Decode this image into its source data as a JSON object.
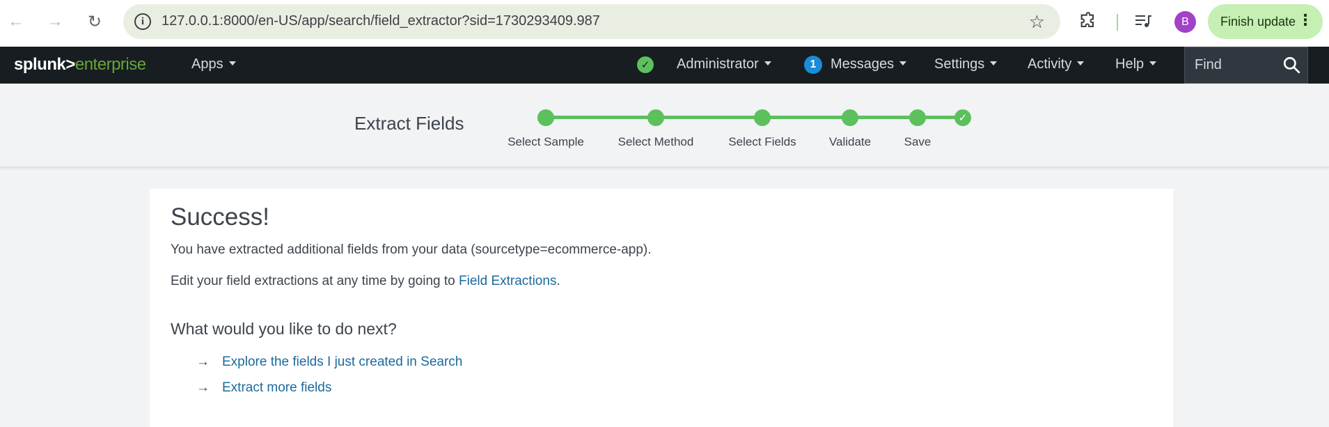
{
  "browser": {
    "url": "127.0.0.1:8000/en-US/app/search/field_extractor?sid=1730293409.987",
    "profile_initial": "B",
    "finish_update_label": "Finish update"
  },
  "splunk_nav": {
    "logo_main": "splunk>",
    "logo_sub": "enterprise",
    "apps_label": "Apps",
    "user_label": "Administrator",
    "messages_count": "1",
    "messages_label": "Messages",
    "settings_label": "Settings",
    "activity_label": "Activity",
    "help_label": "Help",
    "find_placeholder": "Find"
  },
  "wizard": {
    "title": "Extract Fields",
    "steps": [
      {
        "label": "Select Sample"
      },
      {
        "label": "Select Method"
      },
      {
        "label": "Select Fields"
      },
      {
        "label": "Validate"
      },
      {
        "label": "Save"
      }
    ]
  },
  "content": {
    "success_title": "Success!",
    "extracted_text": "You have extracted additional fields from your data (sourcetype=ecommerce-app).",
    "edit_text_before": "Edit your field extractions at any time by going to ",
    "edit_link": "Field Extractions",
    "edit_text_after": ".",
    "next_title": "What would you like to do next?",
    "next_actions": [
      {
        "label": "Explore the fields I just created in Search"
      },
      {
        "label": "Extract more fields"
      }
    ]
  },
  "colors": {
    "accent_green": "#5cc05c",
    "link_blue": "#1a6a9c",
    "nav_bg": "#171d21",
    "logo_green": "#65a637"
  }
}
